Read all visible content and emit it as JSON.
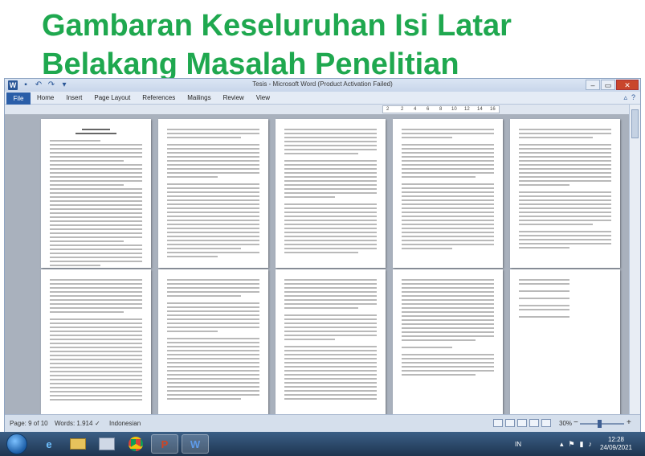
{
  "slide": {
    "title_line1": "Gambaran Keseluruhan Isi Latar",
    "title_line2": "Belakang Masalah  Penelitian"
  },
  "window": {
    "title": "Tesis - Microsoft Word (Product Activation Failed)",
    "controls": {
      "minimize": "–",
      "maximize": "▭",
      "close": "✕"
    }
  },
  "ribbon": {
    "file_label": "File",
    "tabs": [
      "Home",
      "Insert",
      "Page Layout",
      "References",
      "Mailings",
      "Review",
      "View"
    ],
    "help": "?"
  },
  "ruler": {
    "ticks": [
      "2",
      "2",
      "4",
      "6",
      "8",
      "10",
      "12",
      "14",
      "16"
    ]
  },
  "document": {
    "page_headings": [
      "BAB I",
      "PENDAHULUAN"
    ]
  },
  "statusbar": {
    "page": "Page: 9 of 10",
    "words": "Words: 1.914",
    "language": "Indonesian",
    "zoom": "30%",
    "zoom_minus": "−",
    "zoom_plus": "+"
  },
  "taskbar": {
    "apps": [
      "Windows Explorer",
      "Internet Explorer",
      "Files",
      "Chrome",
      "PowerPoint",
      "Word"
    ],
    "language": "IN",
    "time": "12:28",
    "date": "24/09/2021"
  },
  "colors": {
    "title_green": "#1fa84f",
    "word_blue": "#2b5797",
    "ppt_orange": "#d04423"
  }
}
